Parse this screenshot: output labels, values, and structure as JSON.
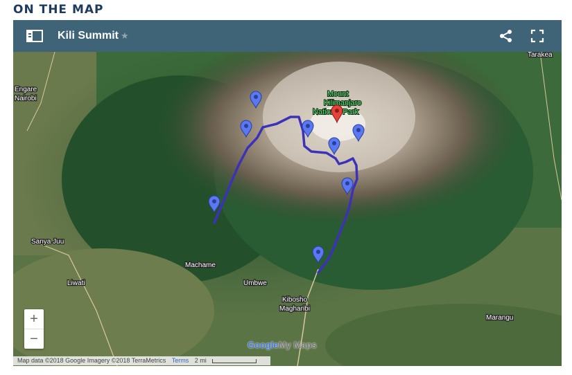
{
  "section_title": "ON THE MAP",
  "map": {
    "title": "Kili Summit",
    "star_glyph": "★",
    "icons": {
      "legend": "legend-panel-icon",
      "star": "star-icon",
      "share": "share-icon",
      "fullscreen": "fullscreen-icon"
    },
    "places": [
      {
        "name": "Engare",
        "key": "engare"
      },
      {
        "name": "Nairobi",
        "key": "nairobi"
      },
      {
        "name": "Sanya Juu",
        "key": "sanya"
      },
      {
        "name": "Liwati",
        "key": "liwati"
      },
      {
        "name": "Machame",
        "key": "machame"
      },
      {
        "name": "Umbwe",
        "key": "umbwe"
      },
      {
        "name": "Kibosho",
        "key": "kibosho"
      },
      {
        "name": "Magharibi",
        "key": "magharibi"
      },
      {
        "name": "Marangu",
        "key": "marangu"
      },
      {
        "name": "Tarakea",
        "key": "tarakea"
      }
    ],
    "park_label": [
      "Mount",
      "Kilimanjaro",
      "National Park"
    ],
    "zoom_in": "+",
    "zoom_out": "−",
    "attribution": "Map data ©2018 Google Imagery ©2018 TerraMetrics",
    "terms": "Terms",
    "scale": "2 mi",
    "logo": {
      "google": "Google",
      "mymaps": "My Maps"
    },
    "colors": {
      "header": "#3f6478",
      "route": "#3c32b8",
      "marker_blue": "#5a78f0",
      "marker_red": "#e8413b"
    }
  }
}
